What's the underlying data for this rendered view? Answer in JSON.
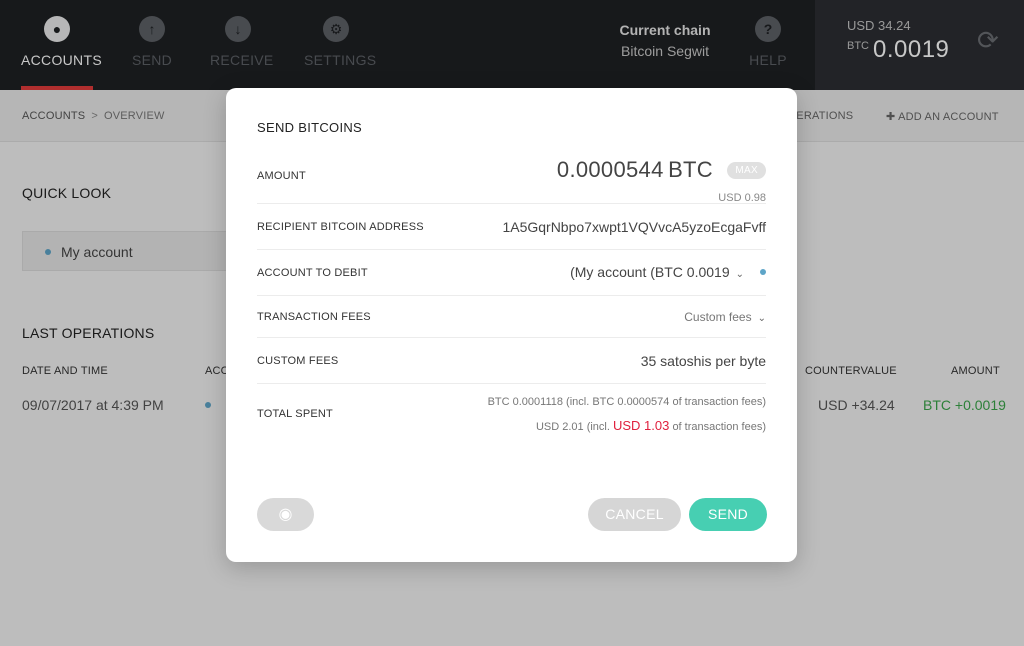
{
  "nav": {
    "items": [
      {
        "label": "ACCOUNTS",
        "icon": "users-icon",
        "glyph": "●"
      },
      {
        "label": "SEND",
        "icon": "arrow-up-icon",
        "glyph": "↑"
      },
      {
        "label": "RECEIVE",
        "icon": "arrow-down-icon",
        "glyph": "↓"
      },
      {
        "label": "SETTINGS",
        "icon": "gear-icon",
        "glyph": "⚙"
      }
    ],
    "help": {
      "label": "HELP",
      "glyph": "?"
    }
  },
  "chain": {
    "title": "Current chain",
    "name": "Bitcoin Segwit"
  },
  "balance": {
    "usd": "USD 34.24",
    "btc_unit": "BTC",
    "btc_value": "0.0019",
    "sync_glyph": "⟳"
  },
  "breadcrumb": {
    "root": "ACCOUNTS",
    "sep": ">",
    "current": "OVERVIEW"
  },
  "subbar": {
    "operations": "OPERATIONS",
    "add_account": "ADD AN ACCOUNT",
    "add_glyph": "✚"
  },
  "overview": {
    "quick_look": "QUICK LOOK",
    "account_name": "My account",
    "last_operations": "LAST OPERATIONS",
    "columns": {
      "date": "DATE AND TIME",
      "account": "ACCOUNT",
      "countervalue": "COUNTERVALUE",
      "amount": "AMOUNT"
    },
    "operation": {
      "date": "09/07/2017 at 4:39 PM",
      "countervalue": "USD +34.24",
      "amount": "BTC +0.0019"
    }
  },
  "modal": {
    "title": "SEND BITCOINS",
    "amount": {
      "label": "AMOUNT",
      "value": "0.0000544",
      "unit": "BTC",
      "max_label": "MAX",
      "usd": "USD 0.98"
    },
    "recipient": {
      "label": "RECIPIENT BITCOIN ADDRESS",
      "value": "1A5GqrNbpo7xwpt1VQVvcA5yzoEcgaFvff"
    },
    "debit": {
      "label": "ACCOUNT TO DEBIT",
      "value": "(My account (BTC 0.0019",
      "chevron": "⌄"
    },
    "fees": {
      "label": "TRANSACTION FEES",
      "value": "Custom fees",
      "chevron": "⌄"
    },
    "custom_fees": {
      "label": "CUSTOM FEES",
      "value": "35 satoshis per byte"
    },
    "total": {
      "label": "TOTAL SPENT",
      "btc_line": "BTC 0.0001118 (incl. BTC 0.0000574 of transaction fees)",
      "usd_prefix": "USD 2.01 (incl.",
      "usd_fee": "USD 1.03",
      "usd_suffix": "of transaction fees)"
    },
    "camera_glyph": "◉",
    "cancel_label": "CANCEL",
    "send_label": "SEND"
  },
  "colors": {
    "accent": "#47cfb2",
    "active_tab": "#e23c3c",
    "fee_red": "#e0213e",
    "positive": "#3aa54a",
    "dot": "#5ea5c8"
  }
}
